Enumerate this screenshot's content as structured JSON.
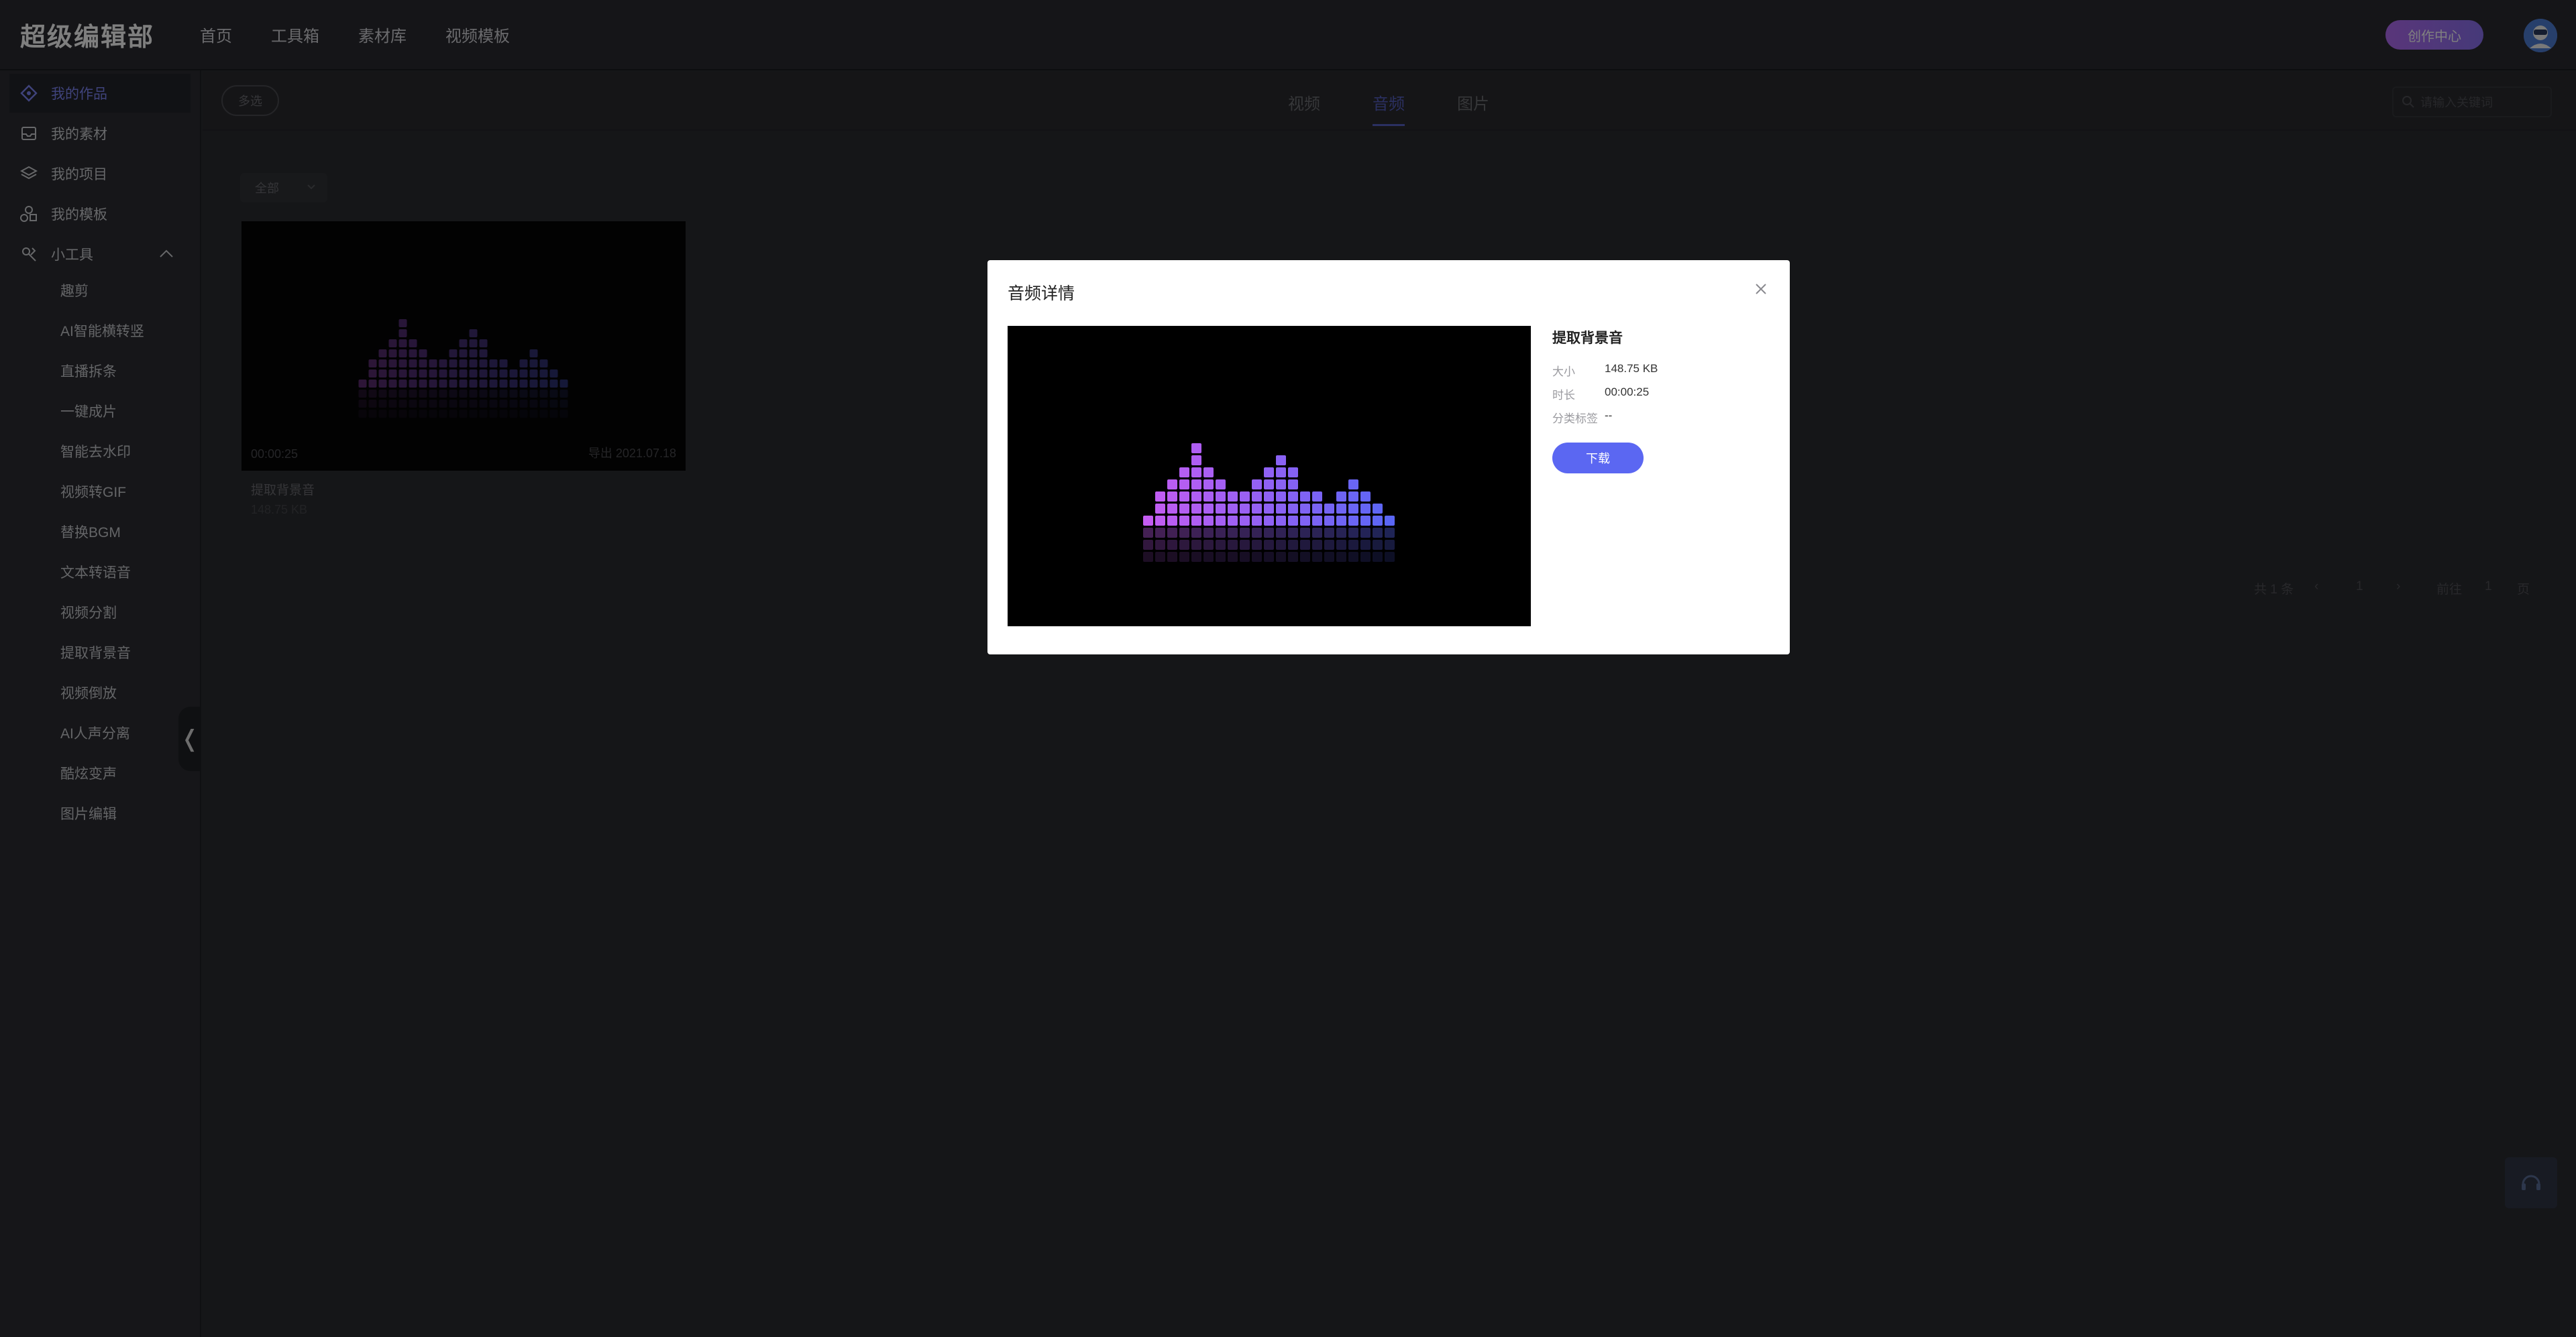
{
  "app": {
    "brand": "超级编辑部"
  },
  "topnav": {
    "items": [
      "首页",
      "工具箱",
      "素材库",
      "视频模板"
    ],
    "create_label": "创作中心"
  },
  "sidebar": {
    "items": [
      {
        "label": "我的作品",
        "icon": "diamond-icon"
      },
      {
        "label": "我的素材",
        "icon": "inbox-icon"
      },
      {
        "label": "我的项目",
        "icon": "layers-icon"
      },
      {
        "label": "我的模板",
        "icon": "shapes-icon"
      },
      {
        "label": "小工具",
        "icon": "tools-icon"
      }
    ],
    "tools": [
      "趣剪",
      "AI智能横转竖",
      "直播拆条",
      "一键成片",
      "智能去水印",
      "视频转GIF",
      "替换BGM",
      "文本转语音",
      "视频分割",
      "提取背景音",
      "视频倒放",
      "AI人声分离",
      "酷炫变声",
      "图片编辑"
    ]
  },
  "subbar": {
    "multi_select": "多选",
    "tabs": [
      "视频",
      "音频",
      "图片"
    ],
    "active_tab": "音频",
    "search_placeholder": "请输入关键词"
  },
  "filter": {
    "selected": "全部"
  },
  "card": {
    "duration": "00:00:25",
    "export": "导出 2021.07.18",
    "title": "提取背景音",
    "size": "148.75 KB"
  },
  "pager": {
    "total": "共 1 条",
    "prev": "‹",
    "page": "1",
    "next": "›",
    "goto": "前往",
    "goto_value": "1",
    "page_unit": "页"
  },
  "modal": {
    "title": "音频详情",
    "name": "提取背景音",
    "size_label": "大小",
    "size": "148.75 KB",
    "duration_label": "时长",
    "duration": "00:00:25",
    "tags_label": "分类标签",
    "tags": "--",
    "download": "下载"
  },
  "colors": {
    "accent": "#5b67f2",
    "active_nav": "#7f87f7",
    "bar_gradient_start": "#c45cf2",
    "bar_gradient_end": "#5a66f5"
  }
}
